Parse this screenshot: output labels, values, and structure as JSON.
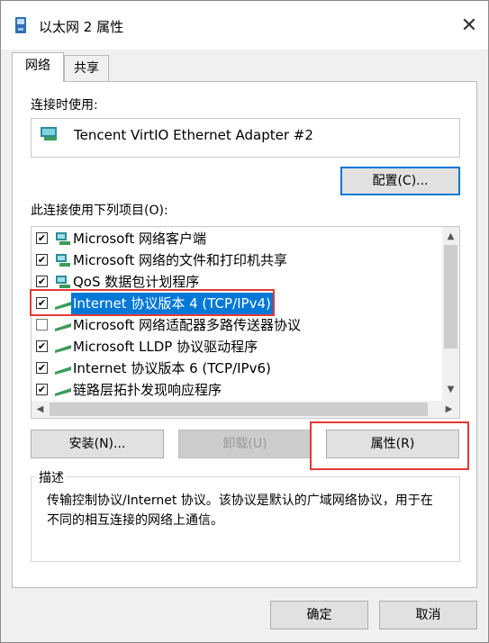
{
  "window": {
    "title": "以太网 2 属性",
    "close_glyph": "✕"
  },
  "tabs": [
    {
      "label": "网络"
    },
    {
      "label": "共享"
    }
  ],
  "connect_using_label": "连接时使用:",
  "adapter": {
    "name": "Tencent VirtIO Ethernet Adapter #2"
  },
  "configure_button": "配置(C)...",
  "items_label": "此连接使用下列项目(O):",
  "items": [
    {
      "label": "Microsoft 网络客户端",
      "checked": true,
      "icon": "network-client-icon"
    },
    {
      "label": "Microsoft 网络的文件和打印机共享",
      "checked": true,
      "icon": "file-printer-sharing-icon"
    },
    {
      "label": "QoS 数据包计划程序",
      "checked": true,
      "icon": "qos-service-icon"
    },
    {
      "label": "Internet 协议版本 4 (TCP/IPv4)",
      "checked": true,
      "icon": "protocol-icon",
      "selected": true
    },
    {
      "label": "Microsoft 网络适配器多路传送器协议",
      "checked": false,
      "icon": "protocol-icon"
    },
    {
      "label": "Microsoft LLDP 协议驱动程序",
      "checked": true,
      "icon": "protocol-icon"
    },
    {
      "label": "Internet 协议版本 6 (TCP/IPv6)",
      "checked": true,
      "icon": "protocol-icon"
    },
    {
      "label": "链路层拓扑发现响应程序",
      "checked": true,
      "icon": "protocol-icon"
    }
  ],
  "buttons": {
    "install": "安装(N)...",
    "uninstall": "卸载(U)",
    "properties": "属性(R)",
    "ok": "确定",
    "cancel": "取消"
  },
  "description": {
    "title": "描述",
    "text": "传输控制协议/Internet 协议。该协议是默认的广域网络协议，用于在不同的相互连接的网络上通信。"
  },
  "colors": {
    "accent": "#0078d7",
    "highlight": "#e53935"
  }
}
